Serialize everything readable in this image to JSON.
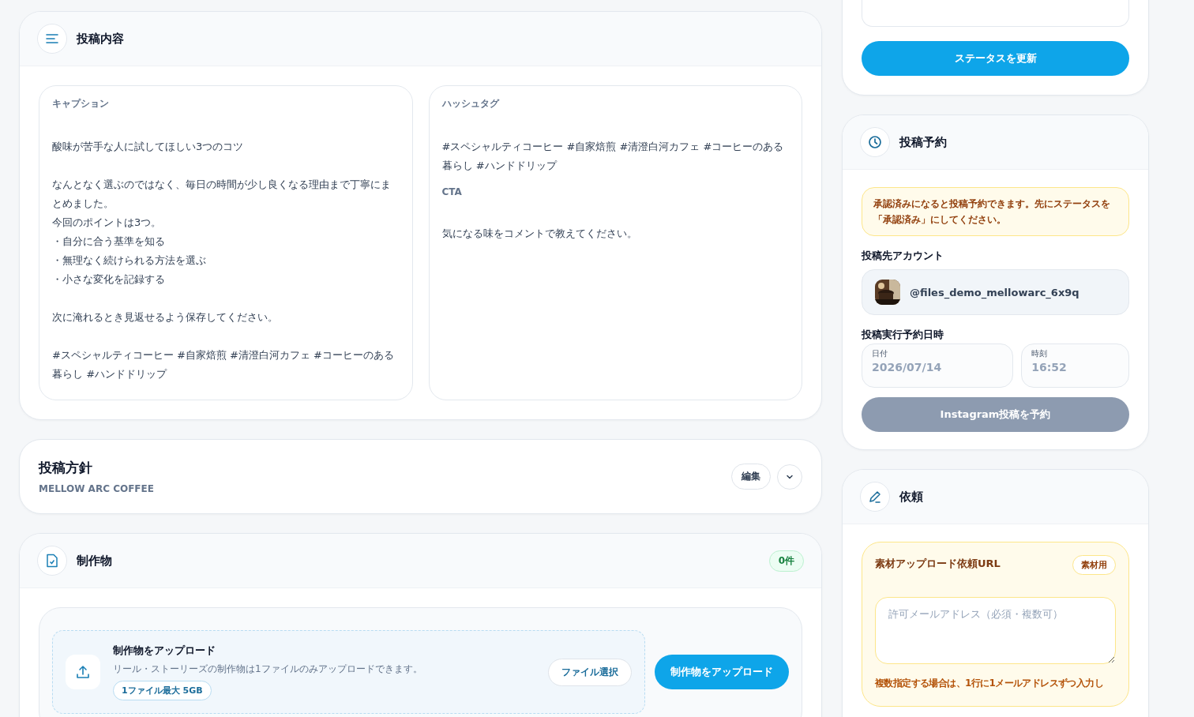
{
  "status_update": {
    "button": "ステータスを更新"
  },
  "post_content": {
    "title": "投稿内容",
    "columns": [
      [
        {
          "label": "キャプション",
          "paragraphs": [
            [
              "酸味が苦手な人に試してほしい3つのコツ"
            ],
            [
              "なんとなく選ぶのではなく、毎日の時間が少し良くなる理由まで丁寧にまとめました。",
              "今回のポイントは3つ。",
              "・自分に合う基準を知る",
              "・無理なく続けられる方法を選ぶ",
              "・小さな変化を記録する"
            ],
            [
              "次に淹れるとき見返せるよう保存してください。"
            ],
            [
              "#スペシャルティコーヒー #自家焙煎 #清澄白河カフェ #コーヒーのある暮らし #ハンドドリップ"
            ]
          ]
        }
      ],
      [
        {
          "label": "ハッシュタグ",
          "paragraphs": [
            [
              "#スペシャルティコーヒー #自家焙煎 #清澄白河カフェ #コーヒーのある暮らし #ハンドドリップ"
            ]
          ]
        },
        {
          "label": "CTA",
          "paragraphs": [
            [
              "気になる味をコメントで教えてください。"
            ]
          ]
        }
      ]
    ]
  },
  "policy": {
    "title": "投稿方針",
    "subtitle": "MELLOW ARC COFFEE",
    "edit_button": "編集",
    "expanded": false
  },
  "deliverables": {
    "title": "制作物",
    "count": "0件",
    "upload": {
      "title": "制作物をアップロード",
      "description": "リール・ストーリーズの制作物は1ファイルのみアップロードできます。",
      "limit": "1ファイル最大 5GB",
      "choose_button": "ファイル選択",
      "upload_button": "制作物をアップロード"
    }
  },
  "schedule": {
    "title": "投稿予約",
    "notice": "承認済みになると投稿予約できます。先にステータスを「承認済み」にしてください。",
    "account_label": "投稿先アカウント",
    "account": "@files_demo_mellowarc_6x9q",
    "datetime_label": "投稿実行予約日時",
    "date_label": "日付",
    "date": "2026/07/14",
    "time_label": "時刻",
    "time": "16:52",
    "submit_button": "Instagram投稿を予約",
    "submit_disabled": true
  },
  "request": {
    "title": "依頼",
    "material": {
      "title": "素材アップロード依頼URL",
      "tag": "素材用",
      "placeholder": "許可メールアドレス（必須・複数可）",
      "hint": "複数指定する場合は、1行に1メールアドレスずつ入力し"
    }
  }
}
